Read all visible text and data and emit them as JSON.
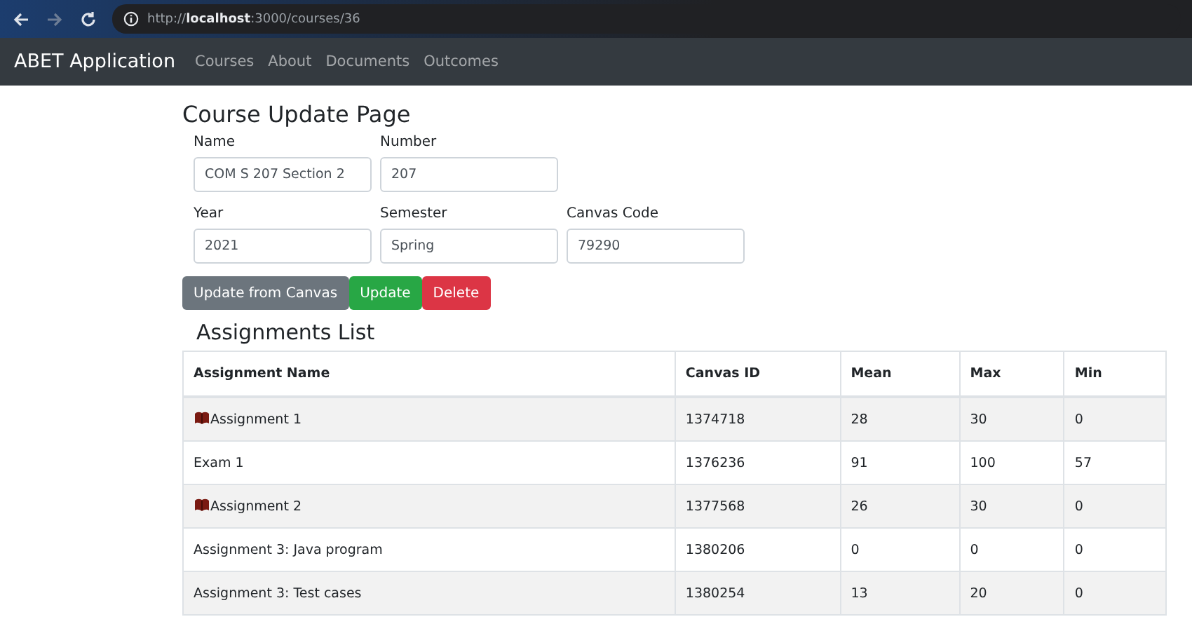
{
  "browser": {
    "url": "http://**localhost**:3000/courses/36"
  },
  "navbar": {
    "brand": "ABET Application",
    "links": [
      "Courses",
      "About",
      "Documents",
      "Outcomes"
    ]
  },
  "page_title": "Course Update Page",
  "fields": [
    [
      {
        "label": "Name",
        "value": "COM S 207 Section 2"
      },
      {
        "label": "Number",
        "value": "207"
      }
    ],
    [
      {
        "label": "Year",
        "value": "2021"
      },
      {
        "label": "Semester",
        "value": "Spring"
      },
      {
        "label": "Canvas Code",
        "value": "79290"
      }
    ]
  ],
  "buttons": [
    {
      "label": "Update from Canvas",
      "kind": "secondary"
    },
    {
      "label": "Update",
      "kind": "success"
    },
    {
      "label": "Delete",
      "kind": "danger"
    }
  ],
  "assignments": {
    "title": "Assignments List",
    "columns": [
      "Assignment Name",
      "Canvas ID",
      "Mean",
      "Max",
      "Min"
    ],
    "rows": [
      {
        "flagged": true,
        "cells": [
          "Assignment 1",
          "1374718",
          "28",
          "30",
          "0"
        ]
      },
      {
        "flagged": false,
        "cells": [
          "Exam 1",
          "1376236",
          "91",
          "100",
          "57"
        ]
      },
      {
        "flagged": true,
        "cells": [
          "Assignment 2",
          "1377568",
          "26",
          "30",
          "0"
        ]
      },
      {
        "flagged": false,
        "cells": [
          "Assignment 3: Java program",
          "1380206",
          "0",
          "0",
          "0"
        ]
      },
      {
        "flagged": false,
        "cells": [
          "Assignment 3: Test cases",
          "1380254",
          "13",
          "20",
          "0"
        ]
      }
    ]
  }
}
